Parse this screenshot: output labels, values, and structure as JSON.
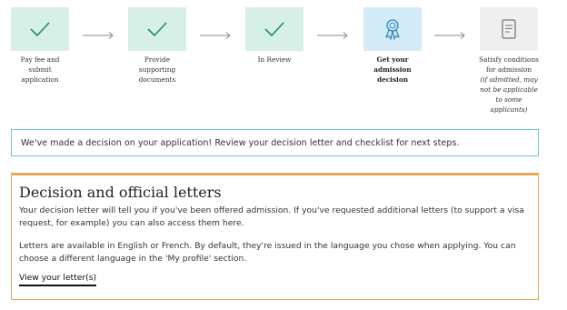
{
  "steps": [
    {
      "label": "Pay fee and submit application",
      "lines": [
        "Pay fee and",
        "submit",
        "application"
      ],
      "state": "done",
      "icon": "check-icon"
    },
    {
      "label": "Provide supporting documents",
      "lines": [
        "Provide",
        "supporting",
        "documents"
      ],
      "state": "done",
      "icon": "check-icon"
    },
    {
      "label": "In Review",
      "lines": [
        "In Review"
      ],
      "state": "done",
      "icon": "check-icon"
    },
    {
      "label": "Get your admission decision",
      "lines": [
        "Get your",
        "admission",
        "decision"
      ],
      "state": "current",
      "icon": "award-ribbon-icon"
    },
    {
      "label": "Satisfy conditions for admission",
      "lines": [
        "Satisfy conditions",
        "for admission"
      ],
      "note_lines": [
        "(if admitted, may",
        "not be applicable",
        "to some",
        "applicants)"
      ],
      "state": "upcoming",
      "icon": "document-icon"
    }
  ],
  "notice": {
    "text": "We've made a decision on your application! Review your decision letter and checklist for next steps."
  },
  "card": {
    "title": "Decision and official letters",
    "para1": "Your decision letter will tell you if you've been offered admission. If you've requested additional letters (to support a visa request, for example) you can also access them here.",
    "para2": "Letters are available in English or French. By default, they're issued in the language you chose when applying. You can choose a different language in the 'My profile' section.",
    "link_label": "View your letter(s)"
  },
  "colors": {
    "done_bg": "#d6efe7",
    "done_icon": "#1e8c6e",
    "current_bg": "#d4ecf7",
    "current_icon": "#2e86b8",
    "upcoming_bg": "#efefef",
    "upcoming_icon": "#777777",
    "notice_border": "#6fbfe0",
    "card_border": "#e6a95a"
  }
}
